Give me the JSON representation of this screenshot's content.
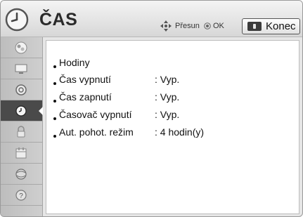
{
  "header": {
    "title": "ČAS",
    "hint_move_label": "Přesun",
    "hint_ok_label": "OK",
    "exit_label": "Konec"
  },
  "sidebar": {
    "items": [
      {
        "icon": "picture-icon"
      },
      {
        "icon": "screen-icon"
      },
      {
        "icon": "speaker-icon"
      },
      {
        "icon": "clock-icon",
        "active": true
      },
      {
        "icon": "lock-icon"
      },
      {
        "icon": "calendar-icon"
      },
      {
        "icon": "network-icon"
      },
      {
        "icon": "help-icon"
      }
    ]
  },
  "menu": {
    "items": [
      {
        "label": "Hodiny",
        "separator": "",
        "value": ""
      },
      {
        "label": "Čas vypnutí",
        "separator": ":",
        "value": "Vyp."
      },
      {
        "label": "Čas zapnutí",
        "separator": ":",
        "value": "Vyp."
      },
      {
        "label": "Časovač vypnutí",
        "separator": ":",
        "value": "Vyp."
      },
      {
        "label": "Aut. pohot. režim",
        "separator": ":",
        "value": "4 hodin(y)"
      }
    ]
  },
  "colors": {
    "header_bg": "#e0e0e0",
    "active_item_bg": "#4a4a4a",
    "content_bg": "#ffffff"
  }
}
